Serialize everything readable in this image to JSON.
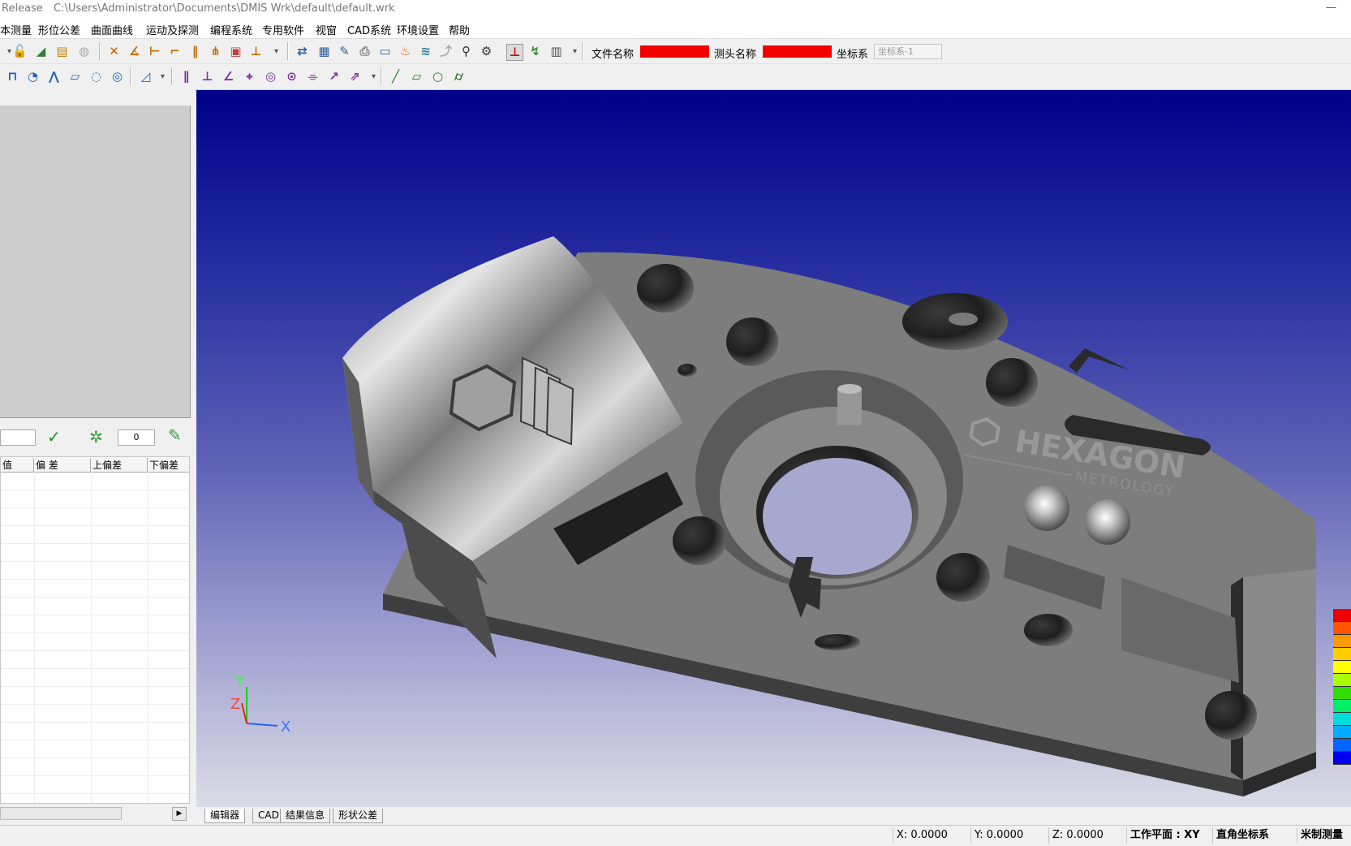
{
  "titlebar": {
    "app": "Release",
    "path": "C:\\Users\\Administrator\\Documents\\DMIS Wrk\\default\\default.wrk",
    "minimize": "—"
  },
  "menu": [
    "本测量",
    "形位公差",
    "曲面曲线",
    "运动及探测",
    "编程系统",
    "专用软件",
    "视窗",
    "CAD系统",
    "环境设置",
    "帮助"
  ],
  "toolbar": {
    "file_label": "文件名称",
    "probe_label": "测头名称",
    "coord_label": "坐标系",
    "coord_value": "坐标系-1",
    "file_color": "#f20000",
    "probe_color": "#f20000"
  },
  "leftpanel": {
    "count_value": "0",
    "columns": [
      "值",
      "偏 差",
      "上偏差",
      "下偏差"
    ],
    "confirm_icon": "check-icon",
    "probe_icon": "probe-icon",
    "pen_icon": "pen-icon"
  },
  "viewport": {
    "axis_y": "Y",
    "axis_z": "Z",
    "axis_x": "X",
    "logo_main": "HEXAGON",
    "logo_sub": "METROLOGY"
  },
  "tabs": [
    "编辑器",
    "CAD",
    "结果信息",
    "形状公差"
  ],
  "status": {
    "x": "X: 0.0000",
    "y": "Y: 0.0000",
    "z": "Z: 0.0000",
    "plane": "工作平面 : XY",
    "coord_sys": "直角坐标系",
    "unit": "米制测量"
  },
  "colorbar": [
    "#ee0000",
    "#ff5500",
    "#ff9900",
    "#ffcc00",
    "#ffff00",
    "#aaff00",
    "#33dd00",
    "#00ee66",
    "#00dddd",
    "#00aaff",
    "#0066ff",
    "#0000ee"
  ]
}
